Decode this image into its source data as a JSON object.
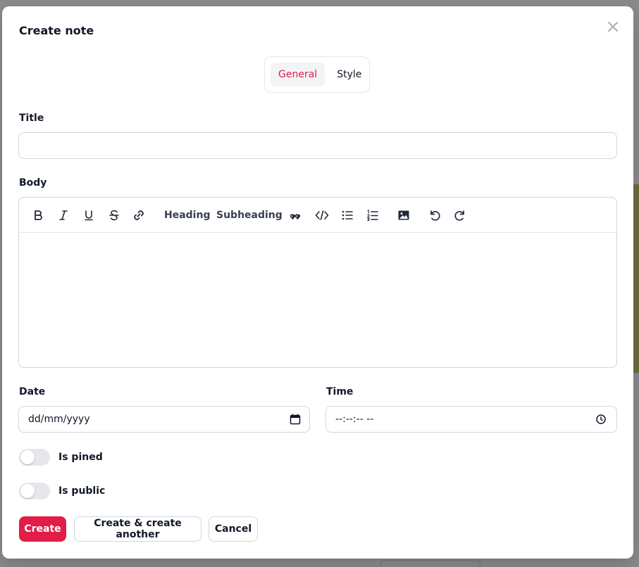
{
  "modal": {
    "title": "Create note"
  },
  "tabs": [
    {
      "label": "General",
      "active": true
    },
    {
      "label": "Style",
      "active": false
    }
  ],
  "fields": {
    "title": {
      "label": "Title",
      "value": "",
      "placeholder": ""
    },
    "body": {
      "label": "Body",
      "toolbar": {
        "heading_label": "Heading",
        "subheading_label": "Subheading"
      }
    },
    "date": {
      "label": "Date",
      "placeholder": "dd/mm/yyyy"
    },
    "time": {
      "label": "Time",
      "placeholder": "--:--:-- --"
    }
  },
  "toggles": [
    {
      "label": "Is pined",
      "on": false
    },
    {
      "label": "Is public",
      "on": false
    }
  ],
  "actions": {
    "create_label": "Create",
    "create_another_label": "Create & create another",
    "cancel_label": "Cancel"
  },
  "colors": {
    "accent": "#e11d48",
    "border": "#d1d5db",
    "toggle_off": "#e5e7eb"
  },
  "icons": [
    "close-icon",
    "bold-icon",
    "italic-icon",
    "underline-icon",
    "strikethrough-icon",
    "link-icon",
    "blockquote-icon",
    "code-icon",
    "bullet-list-icon",
    "ordered-list-icon",
    "image-icon",
    "undo-icon",
    "redo-icon",
    "calendar-icon",
    "clock-icon"
  ]
}
